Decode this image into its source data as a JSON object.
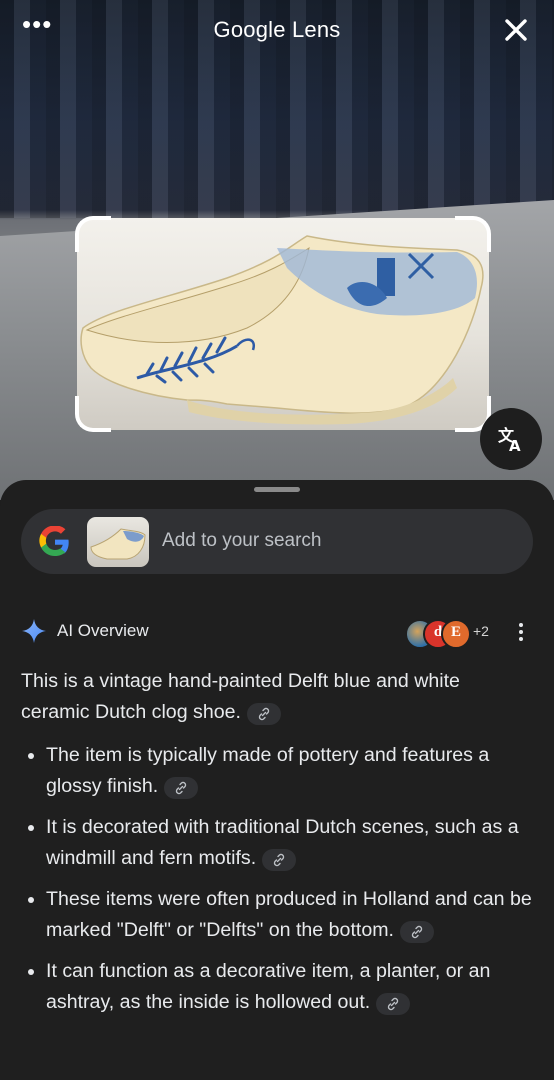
{
  "header": {
    "title": "Google Lens",
    "more_icon": "more-horiz-icon",
    "close_icon": "close-icon"
  },
  "image": {
    "subject": "Delft blue and white ceramic clog shoe",
    "translate_icon": "translate-icon"
  },
  "search": {
    "placeholder": "Add to your search",
    "google_icon": "google-g-icon"
  },
  "ai_overview": {
    "title": "AI Overview",
    "icon": "sparkle-icon",
    "sources": {
      "avatars": [
        "",
        "d",
        "E"
      ],
      "extra_count": "+2"
    },
    "summary": "This is a vintage hand-painted Delft blue and white ceramic Dutch clog shoe.",
    "bullets": [
      "The item is typically made of pottery and features a glossy finish.",
      "It is decorated with traditional Dutch scenes, such as a windmill and fern motifs.",
      "These items were often produced in Holland and can be marked \"Delft\" or \"Delfts\" on the bottom.",
      "It can function as a decorative item, a planter, or an ashtray, as the inside is hollowed out."
    ]
  },
  "colors": {
    "sheet_background": "#1f1f1f",
    "pill_background": "#303134",
    "text": "#e8eaed",
    "accent_blue": "#4c8bf5"
  }
}
